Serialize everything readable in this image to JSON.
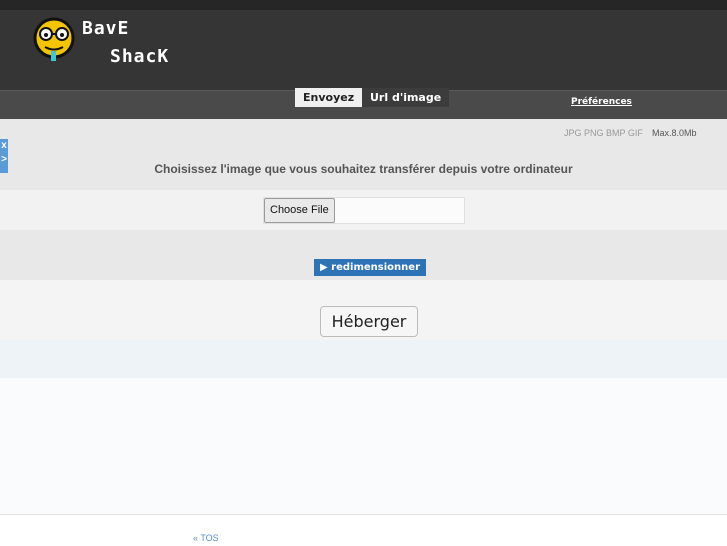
{
  "brand": {
    "line1": "BavE",
    "line2": "ShacK",
    "mascot_icon": "smiley-glasses-icon"
  },
  "nav": {
    "tabs": [
      {
        "label": "Envoyez",
        "active": true
      },
      {
        "label": "Url d'image",
        "active": false
      }
    ],
    "preferences": "Préférences"
  },
  "upload": {
    "formats": "JPG PNG BMP GIF",
    "max_size": "Max.8.0Mb",
    "instruction": "Choisissez l'image que vous souhaitez transférer depuis votre ordinateur",
    "file_button": "Choose File",
    "resize_button": "▶ redimensionner",
    "host_button": "Héberger"
  },
  "side_tab": {
    "close": "x",
    "arrow": ">"
  },
  "footer": {
    "tos": "« TOS"
  },
  "colors": {
    "header": "#353535",
    "navbar": "#4a4a4a",
    "accent": "#2f73b7",
    "side_tab": "#5b9bd5"
  }
}
